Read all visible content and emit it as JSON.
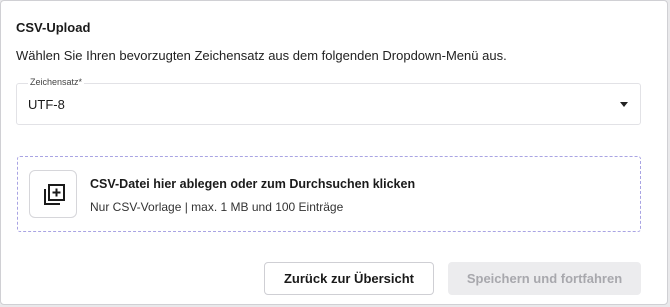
{
  "header": {
    "title": "CSV-Upload",
    "description": "Wählen Sie Ihren bevorzugten Zeichensatz aus dem folgenden Dropdown-Menü aus."
  },
  "charset_select": {
    "label": "Zeichensatz*",
    "selected": "UTF-8",
    "caret_icon": "caret-down"
  },
  "dropzone": {
    "icon": "add-to-library",
    "title": "CSV-Datei hier ablegen oder zum Durchsuchen klicken",
    "hint": "Nur CSV-Vorlage | max. 1 MB und 100 Einträge",
    "border_color": "#a9a4e3"
  },
  "actions": {
    "back_label": "Zurück zur Übersicht",
    "save_label": "Speichern und fortfahren",
    "save_disabled": true
  }
}
